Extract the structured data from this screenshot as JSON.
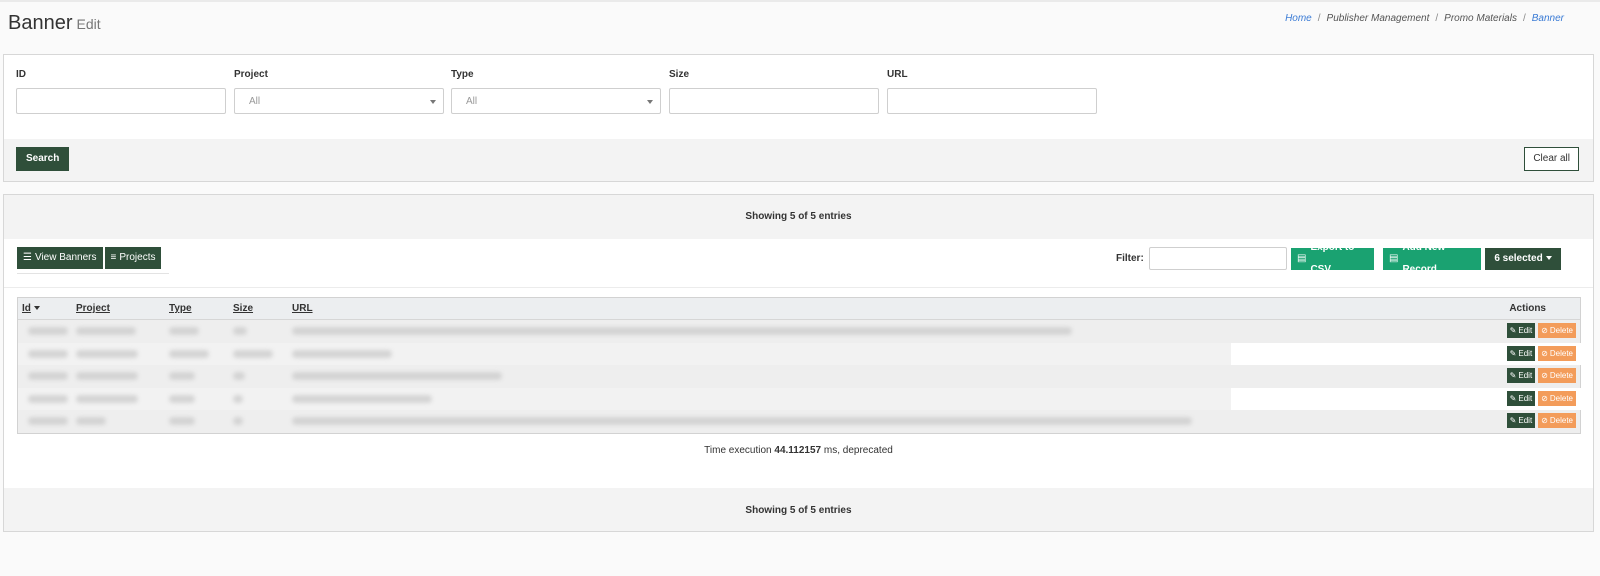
{
  "header": {
    "title": "Banner",
    "subtitle": "Edit",
    "breadcrumb": [
      "Home",
      "Publisher Management",
      "Promo Materials",
      "Banner"
    ]
  },
  "filters": {
    "id_label": "ID",
    "project_label": "Project",
    "project_value": "All",
    "type_label": "Type",
    "type_value": "All",
    "size_label": "Size",
    "url_label": "URL",
    "search_label": "Search",
    "clear_label": "Clear all"
  },
  "results": {
    "showing_top": "Showing 5 of 5 entries",
    "showing_bottom": "Showing 5 of 5 entries",
    "view_banners_label": "View Banners",
    "projects_label": "Projects",
    "filter_label": "Filter:",
    "export_label": "Export to CSV",
    "add_label": "Add New Record",
    "selected_label": "6 selected",
    "time_prefix": "Time execution",
    "time_value": "44.112157",
    "time_suffix": "ms, deprecated"
  },
  "table": {
    "columns": [
      "Id",
      "Project",
      "Type",
      "Size",
      "URL",
      "Actions"
    ],
    "edit_label": "Edit",
    "delete_label": "Delete"
  },
  "colors": {
    "primary_dark": "#2f4f3a",
    "accent_green": "#1aa271",
    "delete_orange": "#f39c5a",
    "link_blue": "#3a7bd5"
  }
}
